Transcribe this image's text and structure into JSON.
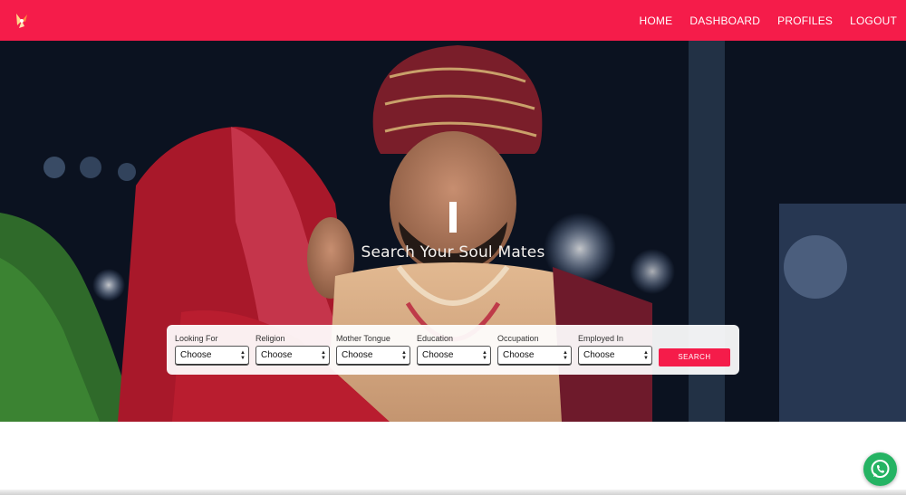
{
  "nav": {
    "logo": "brand-logo-icon",
    "items": [
      "HOME",
      "DASHBOARD",
      "PROFILES",
      "LOGOUT"
    ]
  },
  "hero": {
    "tagline": "Search Your Soul Mates"
  },
  "search": {
    "fields": [
      {
        "label": "Looking For",
        "value": "Choose"
      },
      {
        "label": "Religion",
        "value": "Choose"
      },
      {
        "label": "Mother Tongue",
        "value": "Choose"
      },
      {
        "label": "Education",
        "value": "Choose"
      },
      {
        "label": "Occupation",
        "value": "Choose"
      },
      {
        "label": "Employed In",
        "value": "Choose"
      }
    ],
    "button": "SEARCH"
  },
  "colors": {
    "brand": "#f51c4a",
    "whatsapp": "#25b363"
  },
  "icons": {
    "float": "whatsapp-icon"
  }
}
